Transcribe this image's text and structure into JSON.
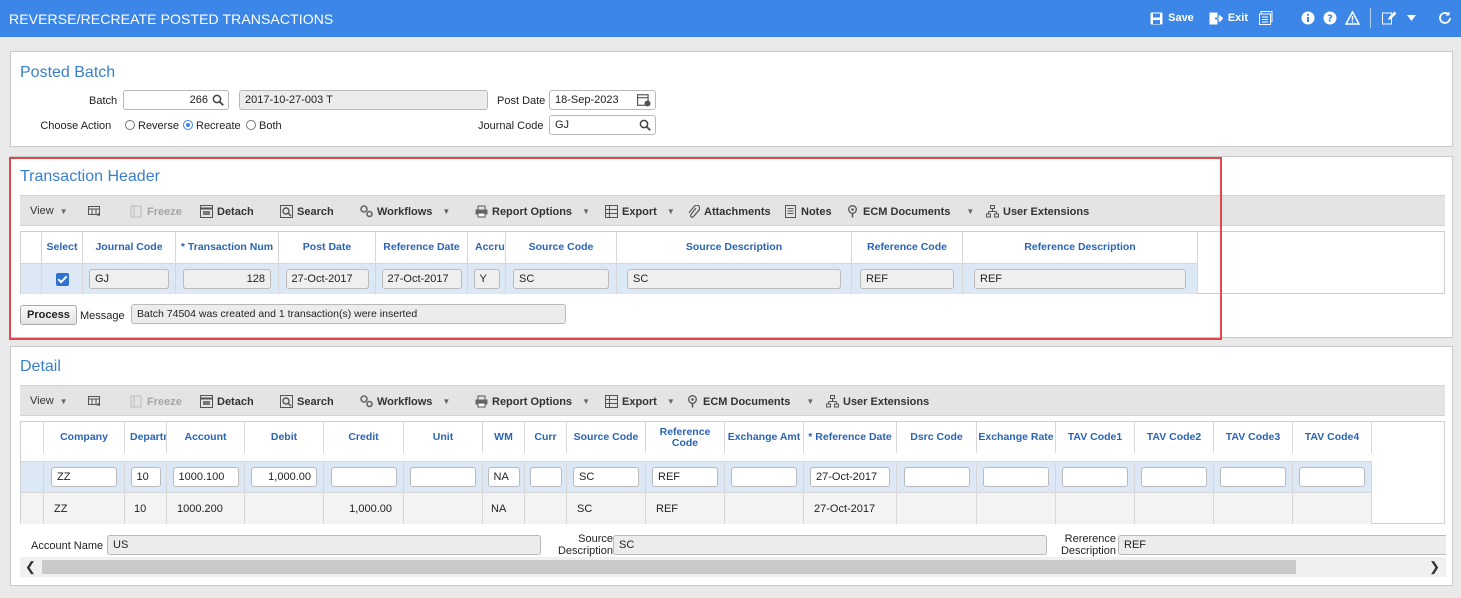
{
  "window": {
    "title": "REVERSE/RECREATE POSTED TRANSACTIONS",
    "save_label": "Save",
    "exit_label": "Exit"
  },
  "posted_batch": {
    "title": "Posted Batch",
    "batch_label": "Batch",
    "batch_value": "266",
    "batch_desc": "2017-10-27-003 T",
    "post_date_label": "Post Date",
    "post_date_value": "18-Sep-2023",
    "action_label": "* Choose Action",
    "action_options": [
      "Reverse",
      "Recreate",
      "Both"
    ],
    "action_selected": "Recreate",
    "journal_code_label": "Journal Code",
    "journal_code_value": "GJ"
  },
  "transaction_header": {
    "title": "Transaction Header",
    "toolbar": {
      "view": "View",
      "freeze": "Freeze",
      "detach": "Detach",
      "search": "Search",
      "workflows": "Workflows",
      "report_options": "Report Options",
      "export": "Export",
      "attachments": "Attachments",
      "notes": "Notes",
      "ecm_documents": "ECM Documents",
      "user_extensions": "User Extensions"
    },
    "columns": [
      "Select",
      "Journal Code",
      "* Transaction Num",
      "Post Date",
      "Reference Date",
      "Accrual",
      "Source Code",
      "Source Description",
      "Reference Code",
      "Reference Description"
    ],
    "row": {
      "selected": true,
      "journal_code": "GJ",
      "transaction_num": "128",
      "post_date": "27-Oct-2017",
      "reference_date": "27-Oct-2017",
      "accrual": "Y",
      "source_code": "SC",
      "source_description": "SC",
      "reference_code": "REF",
      "reference_description": "REF"
    },
    "process_label": "Process",
    "message_label": "Message",
    "message_value": "Batch 74504 was created and 1 transaction(s) were inserted"
  },
  "detail": {
    "title": "Detail",
    "toolbar": {
      "view": "View",
      "freeze": "Freeze",
      "detach": "Detach",
      "search": "Search",
      "workflows": "Workflows",
      "report_options": "Report Options",
      "export": "Export",
      "ecm_documents": "ECM Documents",
      "user_extensions": "User Extensions"
    },
    "columns": [
      "Company",
      "Department",
      "Account",
      "Debit",
      "Credit",
      "Unit",
      "WM",
      "Curr",
      "Source Code",
      "Reference Code",
      "Exchange Amt",
      "* Reference Date",
      "Dsrc Code",
      "Exchange Rate",
      "TAV Code1",
      "TAV Code2",
      "TAV Code3",
      "TAV Code4"
    ],
    "rows": [
      {
        "company": "ZZ",
        "department": "10",
        "account": "1000.100",
        "debit": "1,000.00",
        "credit": "",
        "unit": "",
        "wm": "NA",
        "curr": "",
        "source_code": "SC",
        "reference_code": "REF",
        "exchange_amt": "",
        "reference_date": "27-Oct-2017",
        "dsrc_code": "",
        "exchange_rate": "",
        "tav1": "",
        "tav2": "",
        "tav3": "",
        "tav4": ""
      },
      {
        "company": "ZZ",
        "department": "10",
        "account": "1000.200",
        "debit": "",
        "credit": "1,000.00",
        "unit": "",
        "wm": "NA",
        "curr": "",
        "source_code": "SC",
        "reference_code": "REF",
        "exchange_amt": "",
        "reference_date": "27-Oct-2017",
        "dsrc_code": "",
        "exchange_rate": "",
        "tav1": "",
        "tav2": "",
        "tav3": "",
        "tav4": ""
      }
    ],
    "account_name_label": "Account Name",
    "account_name_value": "US",
    "source_desc_label_1": "Source",
    "source_desc_label_2": "Description",
    "source_desc_value": "SC",
    "ref_desc_label_1": "Rererence",
    "ref_desc_label_2": "Description",
    "ref_desc_value": "REF"
  },
  "colors": {
    "titlebar": "#3b86e6",
    "section_title": "#3a7fcf",
    "column_header": "#2a64b5",
    "highlight_border": "#e0474c",
    "selected_row": "#dde8f7"
  },
  "icons": [
    "save-icon",
    "exit-icon",
    "report-icon",
    "info-icon",
    "help-icon",
    "warning-icon",
    "edit-icon",
    "refresh-icon",
    "search-icon",
    "calendar-icon"
  ]
}
